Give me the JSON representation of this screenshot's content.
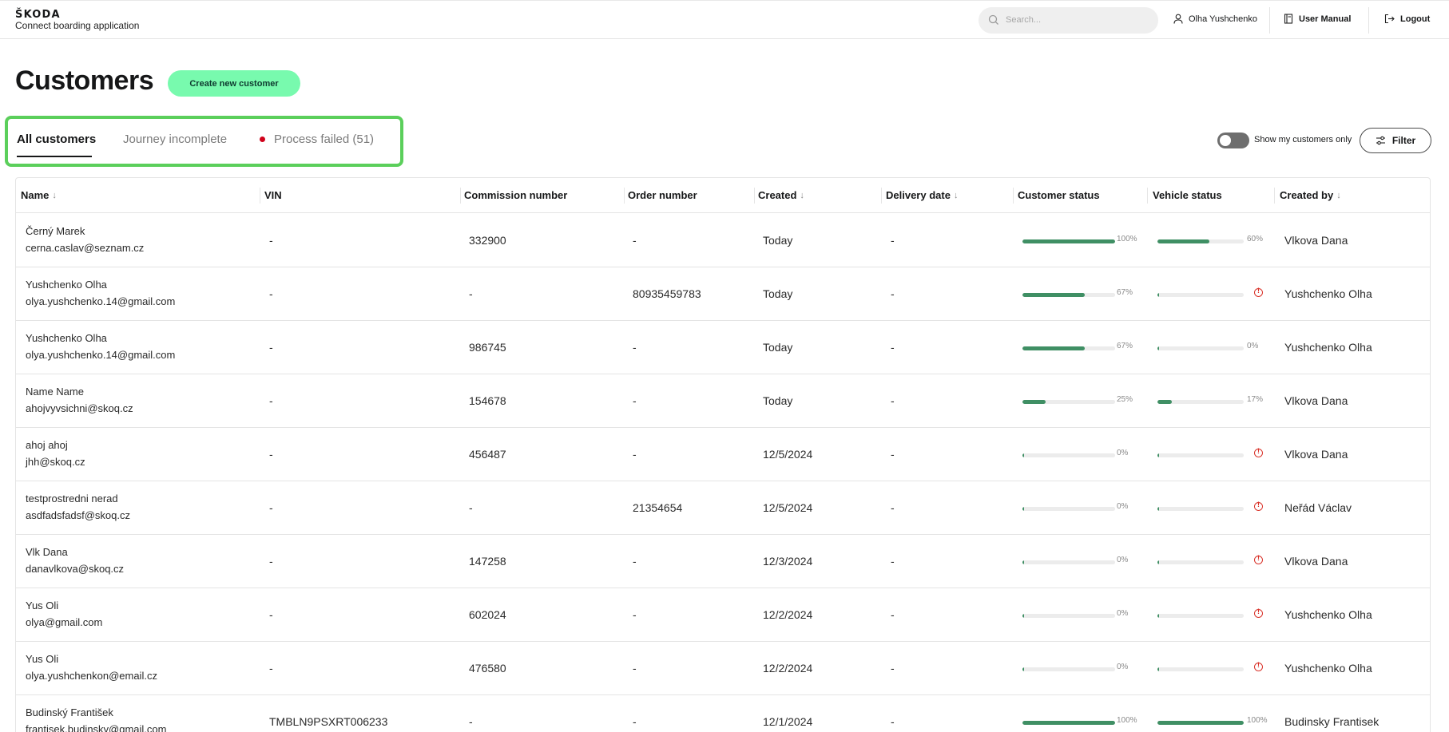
{
  "header": {
    "logo": "ŠKODA",
    "app_name": "Connect boarding application",
    "search_placeholder": "Search...",
    "user_name": "Olha Yushchenko",
    "manual_label": "User Manual",
    "logout_label": "Logout"
  },
  "page": {
    "title": "Customers",
    "create_button": "Create new customer"
  },
  "tabs": [
    {
      "label": "All customers",
      "active": true
    },
    {
      "label": "Journey incomplete",
      "active": false
    },
    {
      "label": "Process failed (51)",
      "active": false
    }
  ],
  "toolbar": {
    "toggle_label": "Show my customers only",
    "toggle_on": false,
    "filter_label": "Filter"
  },
  "table": {
    "columns": [
      "Name",
      "VIN",
      "Commission number",
      "Order number",
      "Created",
      "Delivery date",
      "Customer status",
      "Vehicle status",
      "Created by"
    ],
    "rows": [
      {
        "name": "Černý Marek",
        "email": "cerna.caslav@seznam.cz",
        "vin": "-",
        "commission": "332900",
        "order": "-",
        "created": "Today",
        "delivery": "-",
        "customer_status": 100,
        "customer_status_label": "100%",
        "vehicle_status": 60,
        "vehicle_status_label": "60%",
        "vehicle_error": false,
        "created_by": "Vlkova Dana"
      },
      {
        "name": "Yushchenko Olha",
        "email": "olya.yushchenko.14@gmail.com",
        "vin": "-",
        "commission": "-",
        "order": "80935459783",
        "created": "Today",
        "delivery": "-",
        "customer_status": 67,
        "customer_status_label": "67%",
        "vehicle_status": 0,
        "vehicle_status_label": "",
        "vehicle_error": true,
        "created_by": "Yushchenko Olha"
      },
      {
        "name": "Yushchenko Olha",
        "email": "olya.yushchenko.14@gmail.com",
        "vin": "-",
        "commission": "986745",
        "order": "-",
        "created": "Today",
        "delivery": "-",
        "customer_status": 67,
        "customer_status_label": "67%",
        "vehicle_status": 0,
        "vehicle_status_label": "0%",
        "vehicle_error": false,
        "created_by": "Yushchenko Olha"
      },
      {
        "name": "Name Name",
        "email": "ahojvyvsichni@skoq.cz",
        "vin": "-",
        "commission": "154678",
        "order": "-",
        "created": "Today",
        "delivery": "-",
        "customer_status": 25,
        "customer_status_label": "25%",
        "vehicle_status": 17,
        "vehicle_status_label": "17%",
        "vehicle_error": false,
        "created_by": "Vlkova Dana"
      },
      {
        "name": "ahoj ahoj",
        "email": "jhh@skoq.cz",
        "vin": "-",
        "commission": "456487",
        "order": "-",
        "created": "12/5/2024",
        "delivery": "-",
        "customer_status": 0,
        "customer_status_label": "0%",
        "vehicle_status": 0,
        "vehicle_status_label": "",
        "vehicle_error": true,
        "created_by": "Vlkova Dana"
      },
      {
        "name": "testprostredni nerad",
        "email": "asdfadsfadsf@skoq.cz",
        "vin": "-",
        "commission": "-",
        "order": "21354654",
        "created": "12/5/2024",
        "delivery": "-",
        "customer_status": 0,
        "customer_status_label": "0%",
        "vehicle_status": 0,
        "vehicle_status_label": "",
        "vehicle_error": true,
        "created_by": "Neřád Václav"
      },
      {
        "name": "Vlk Dana",
        "email": "danavlkova@skoq.cz",
        "vin": "-",
        "commission": "147258",
        "order": "-",
        "created": "12/3/2024",
        "delivery": "-",
        "customer_status": 0,
        "customer_status_label": "0%",
        "vehicle_status": 0,
        "vehicle_status_label": "",
        "vehicle_error": true,
        "created_by": "Vlkova Dana"
      },
      {
        "name": "Yus Oli",
        "email": "olya@gmail.com",
        "vin": "-",
        "commission": "602024",
        "order": "-",
        "created": "12/2/2024",
        "delivery": "-",
        "customer_status": 0,
        "customer_status_label": "0%",
        "vehicle_status": 0,
        "vehicle_status_label": "",
        "vehicle_error": true,
        "created_by": "Yushchenko Olha"
      },
      {
        "name": "Yus Oli",
        "email": "olya.yushchenkon@email.cz",
        "vin": "-",
        "commission": "476580",
        "order": "-",
        "created": "12/2/2024",
        "delivery": "-",
        "customer_status": 0,
        "customer_status_label": "0%",
        "vehicle_status": 0,
        "vehicle_status_label": "",
        "vehicle_error": true,
        "created_by": "Yushchenko Olha"
      },
      {
        "name": "Budinský František",
        "email": "frantisek.budinsky@gmail.com",
        "vin": "TMBLN9PSXRT006233",
        "commission": "-",
        "order": "-",
        "created": "12/1/2024",
        "delivery": "-",
        "customer_status": 100,
        "customer_status_label": "100%",
        "vehicle_status": 100,
        "vehicle_status_label": "100%",
        "vehicle_error": false,
        "created_by": "Budinsky Frantisek"
      }
    ]
  },
  "colors": {
    "accent_green": "#78faae",
    "progress_green": "#3f8f64",
    "error_red": "#d9332a",
    "highlight_outline": "#5bcf5b"
  }
}
